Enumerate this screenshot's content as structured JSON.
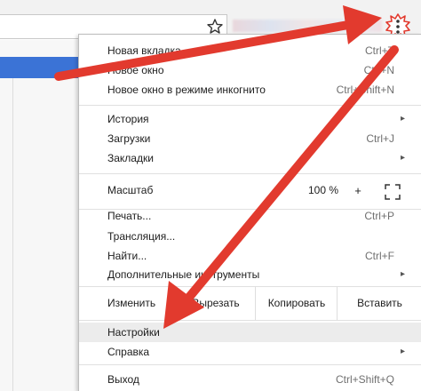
{
  "menu": {
    "new_tab": {
      "label": "Новая вкладка",
      "shortcut": "Ctrl+T"
    },
    "new_window": {
      "label": "Новое окно",
      "shortcut": "Ctrl+N"
    },
    "incognito": {
      "label": "Новое окно в режиме инкогнито",
      "shortcut": "Ctrl+Shift+N"
    },
    "history": {
      "label": "История",
      "arrow": "▸"
    },
    "downloads": {
      "label": "Загрузки",
      "shortcut": "Ctrl+J"
    },
    "bookmarks": {
      "label": "Закладки",
      "arrow": "▸"
    },
    "zoom": {
      "label": "Масштаб",
      "value": "100 %",
      "plus": "+"
    },
    "print": {
      "label": "Печать...",
      "shortcut": "Ctrl+P"
    },
    "cast": {
      "label": "Трансляция..."
    },
    "find": {
      "label": "Найти...",
      "shortcut": "Ctrl+F"
    },
    "more_tools": {
      "label": "Дополнительные инструменты",
      "arrow": "▸"
    },
    "edit": {
      "label": "Изменить",
      "cut": "Вырезать",
      "copy": "Копировать",
      "paste": "Вставить"
    },
    "settings": {
      "label": "Настройки"
    },
    "help": {
      "label": "Справка",
      "arrow": "▸"
    },
    "exit": {
      "label": "Выход",
      "shortcut": "Ctrl+Shift+Q"
    }
  },
  "icons": {
    "star": "star-icon",
    "kebab": "vertical-dots-icon",
    "fullscreen": "fullscreen-icon"
  },
  "colors": {
    "annotation_red": "#e23a2e",
    "blue_bar": "#3b73d6",
    "highlight": "#ececec"
  }
}
